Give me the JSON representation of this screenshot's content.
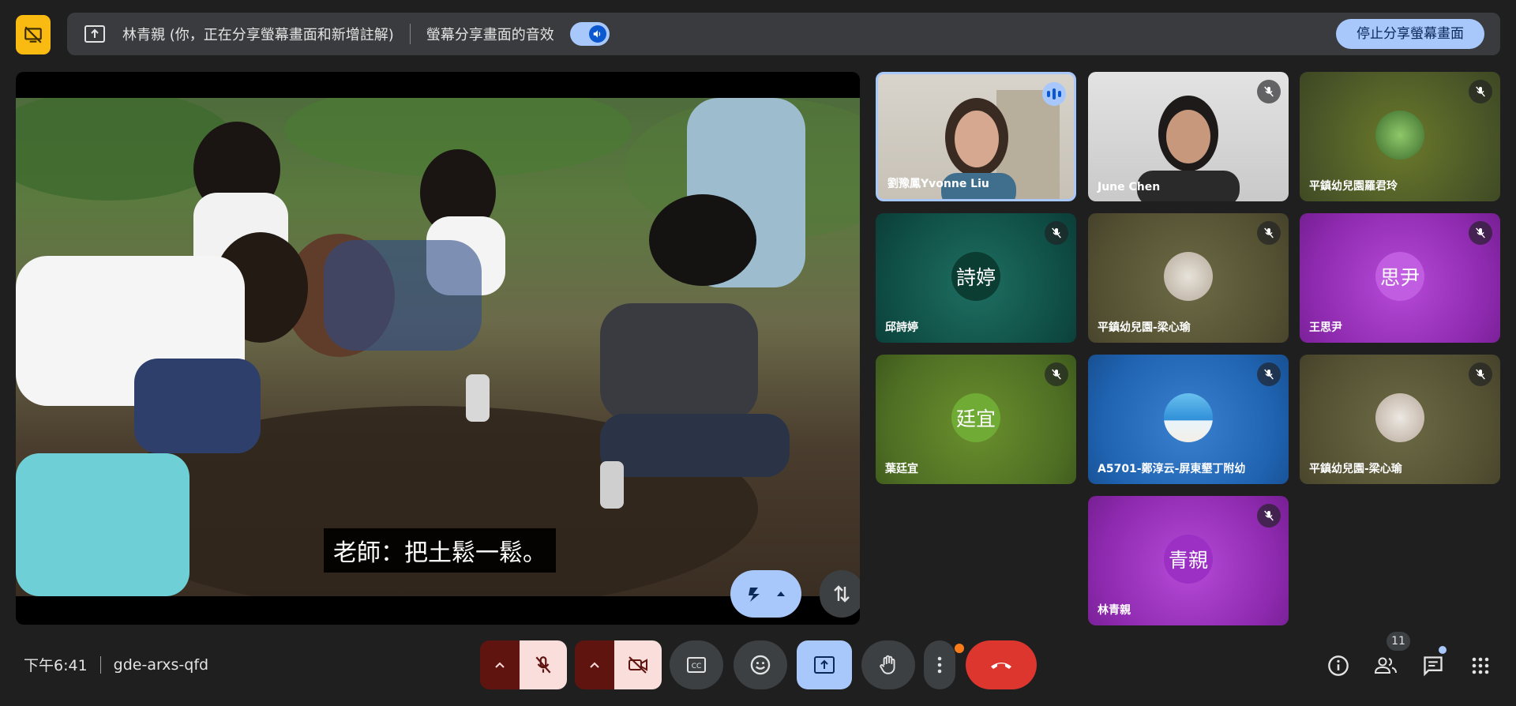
{
  "banner": {
    "presenter_text": "林青親 (你，正在分享螢幕畫面和新增註解)",
    "audio_label": "螢幕分享畫面的音效",
    "audio_toggle_on": true,
    "stop_share_label": "停止分享螢幕畫面"
  },
  "shared_screen": {
    "caption": "老師：把土鬆一鬆。"
  },
  "participants": [
    {
      "name": "劉豫鳳Yvonne Liu",
      "initials": "",
      "speaking": true,
      "muted": false
    },
    {
      "name": "June Chen",
      "initials": "",
      "speaking": false,
      "muted": true
    },
    {
      "name": "平鎮幼兒園羅君玲",
      "initials": "",
      "speaking": false,
      "muted": true
    },
    {
      "name": "邱詩婷",
      "initials": "詩婷",
      "speaking": false,
      "muted": true
    },
    {
      "name": "平鎮幼兒園-梁心瑜",
      "initials": "",
      "speaking": false,
      "muted": true
    },
    {
      "name": "王思尹",
      "initials": "思尹",
      "speaking": false,
      "muted": true
    },
    {
      "name": "葉廷宜",
      "initials": "廷宜",
      "speaking": false,
      "muted": true
    },
    {
      "name": "A5701-鄭淳云-屏東墾丁附幼",
      "initials": "",
      "speaking": false,
      "muted": true
    },
    {
      "name": "平鎮幼兒園-梁心瑜",
      "initials": "",
      "speaking": false,
      "muted": true
    },
    {
      "name": "林青親",
      "initials": "青親",
      "speaking": false,
      "muted": true
    }
  ],
  "meeting": {
    "time": "下午6:41",
    "code": "gde-arxs-qfd",
    "participant_count": "11"
  },
  "colors": {
    "accent": "#a8c7fa",
    "danger": "#dc362e",
    "muted_bg": "#f9dedc",
    "notice": "#f9bb11"
  }
}
